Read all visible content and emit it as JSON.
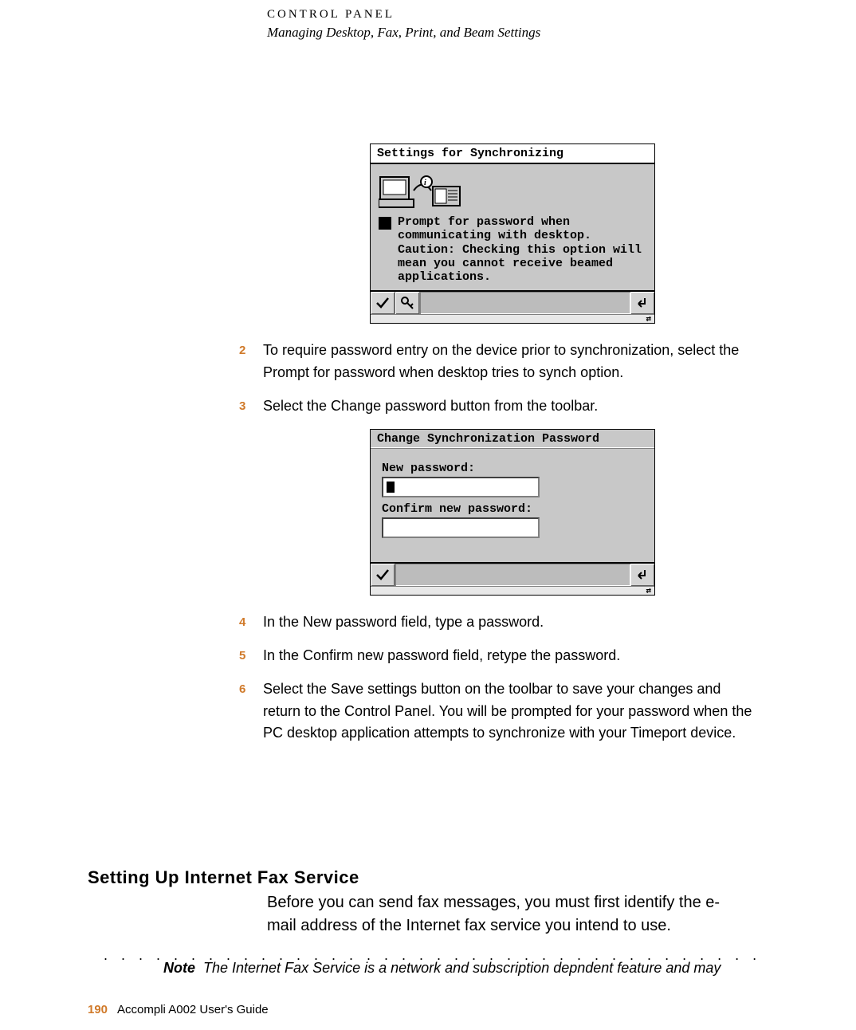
{
  "header": {
    "chapter": "CONTROL PANEL",
    "subtitle": "Managing Desktop, Fax, Print, and Beam Settings"
  },
  "screenshot1": {
    "title": "Settings for Synchronizing",
    "prompt_text": "Prompt for password when communicating with desktop. Caution: Checking this option will mean you cannot receive beamed applications.",
    "btn_check": "✔",
    "btn_key": "🔑",
    "btn_back": "↰",
    "corner": "⇄"
  },
  "screenshot2": {
    "title": "Change Synchronization Password",
    "label_new": "New password:",
    "label_confirm": "Confirm new password:",
    "btn_check": "✔",
    "btn_back": "↰",
    "corner": "⇄"
  },
  "steps": {
    "s2_num": "2",
    "s2_text": "To require password entry on the device prior to synchronization, select the Prompt for password when desktop tries to synch option.",
    "s3_num": "3",
    "s3_text": "Select the Change password button from the toolbar.",
    "s4_num": "4",
    "s4_text": "In the New password field, type a password.",
    "s5_num": "5",
    "s5_text": "In the Confirm new password field, retype the password.",
    "s6_num": "6",
    "s6_text": "Select the Save settings button on the toolbar to save your changes and return to the Control Panel. You will be prompted for your password when the PC desktop application attempts to synchronize with your Timeport device."
  },
  "section": {
    "heading": "Setting Up Internet Fax Service",
    "body": "Before you can send fax messages, you must first identify the e-mail address of the Internet fax service you intend to use."
  },
  "note": {
    "label": "Note",
    "text": "The Internet Fax Service is a network and subscription depndent feature and may"
  },
  "footer": {
    "page": "190",
    "book": "Accompli A002 User's Guide"
  },
  "dots": ". . . . . . . . . . . . . . . . . . . . . . . . . . . . . . . . . . . . . . . . . . . . . . . . . . . . . . . . . . . ."
}
